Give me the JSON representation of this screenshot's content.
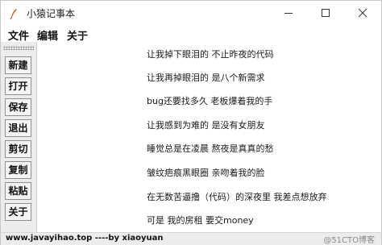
{
  "window": {
    "title": "小猿记事本",
    "icon": "feather-pen-icon",
    "controls": {
      "minimize": "minimize-icon",
      "maximize": "maximize-icon",
      "close": "close-icon"
    }
  },
  "menu": {
    "items": [
      "文件",
      "编辑",
      "关于"
    ]
  },
  "toolbar": {
    "buttons": [
      "新建",
      "打开",
      "保存",
      "退出",
      "剪切",
      "复制",
      "粘贴",
      "关于"
    ]
  },
  "editor": {
    "lines": [
      "让我掉下眼泪的 不止昨夜的代码",
      "让我再掉眼泪的 是八个新需求",
      "bug还要找多久 老板爆着我的手",
      "让我感到为难的 是没有女朋友",
      "睡觉总是在凌晨 熬夜是真真的愁",
      "皱纹疤痕黑眼圈 亲吻着我的脸",
      "在无数苦逼撸（代码）的深夜里 我差点想放弃",
      "可是 我的房租 要交money"
    ]
  },
  "status": {
    "text": "www.javayihao.top ----by xiaoyuan",
    "watermark": "@51CTO博客"
  },
  "colors": {
    "window_bg": "#ffffff",
    "sidebar_bg": "#ececec",
    "button_border": "#8f8f8f"
  }
}
